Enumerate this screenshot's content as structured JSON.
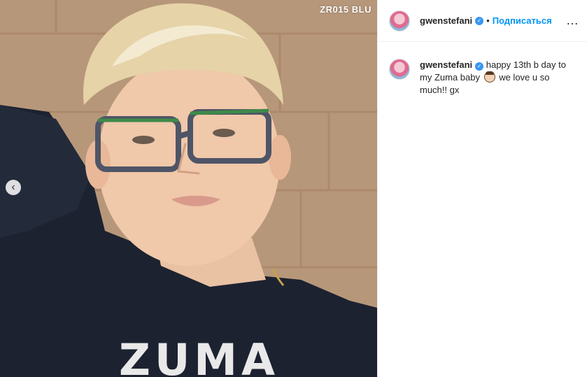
{
  "post": {
    "watermark": "ZR015 BLU",
    "shirt_text": "ZUMA",
    "prev_icon": "‹"
  },
  "header": {
    "username": "gwenstefani",
    "verified_glyph": "✓",
    "separator": "•",
    "follow_label": "Подписаться",
    "more_glyph": "…"
  },
  "caption": {
    "username": "gwenstefani",
    "verified_glyph": "✓",
    "text_part1": " happy 13th b day to my Zuma baby ",
    "text_part2": " we love u so much!! gx"
  },
  "colors": {
    "link": "#0095f6",
    "verified": "#3897f0",
    "text": "#262626"
  }
}
